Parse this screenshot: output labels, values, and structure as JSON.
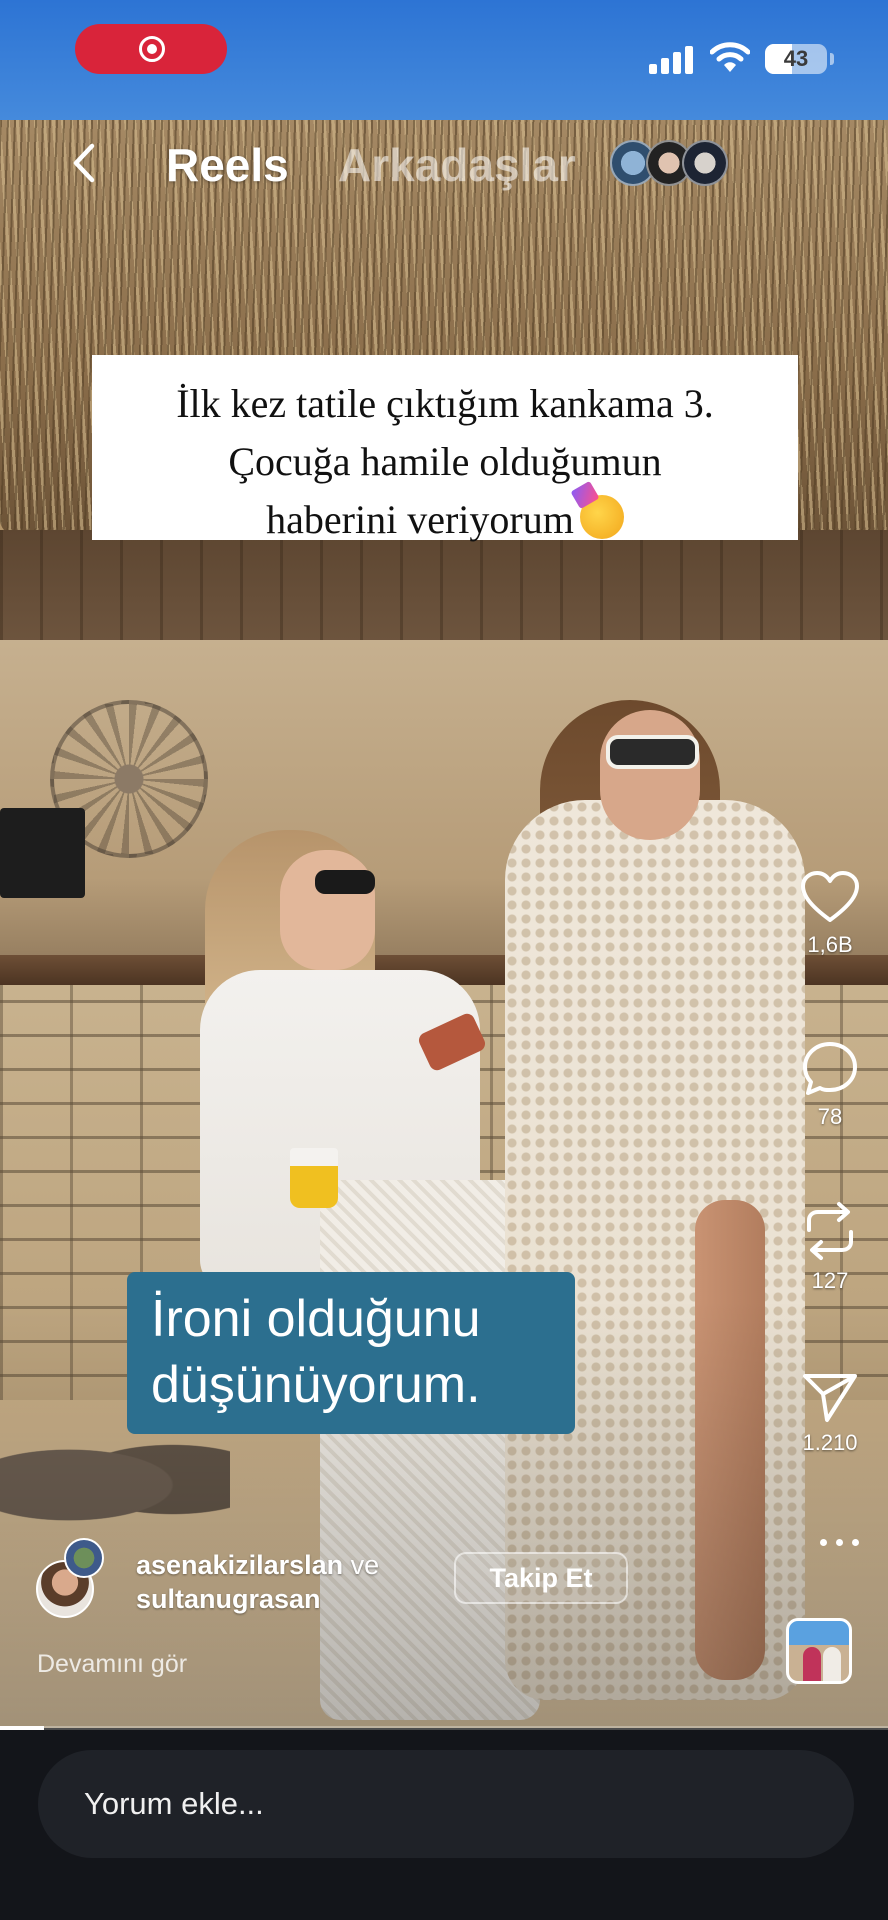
{
  "status_bar": {
    "battery_label": "43",
    "battery_level": 0.43
  },
  "header": {
    "title": "Reels",
    "secondary_tab": "Arkadaşlar"
  },
  "overlay": {
    "caption_line_1": "İlk kez tatile çıktığım kankama 3.",
    "caption_line_2": "Çocuğa hamile olduğumun",
    "caption_line_3": "haberini veriyorum",
    "subtitle_line_1": "İroni olduğunu",
    "subtitle_line_2": "düşünüyorum."
  },
  "actions": {
    "likes": "1,6B",
    "comments": "78",
    "reposts": "127",
    "shares": "1.210"
  },
  "author": {
    "name_1": "asenakizilarslan",
    "connector": "ve",
    "name_2": "sultanugrasan",
    "follow_label": "Takip Et",
    "see_more": "Devamını gör"
  },
  "comment": {
    "placeholder": "Yorum ekle..."
  },
  "playback": {
    "progress": 0.05
  },
  "colors": {
    "record_pill": "#d9243a",
    "subtitle_bg": "#2c6f8f",
    "bottom_bar": "#13151a"
  }
}
